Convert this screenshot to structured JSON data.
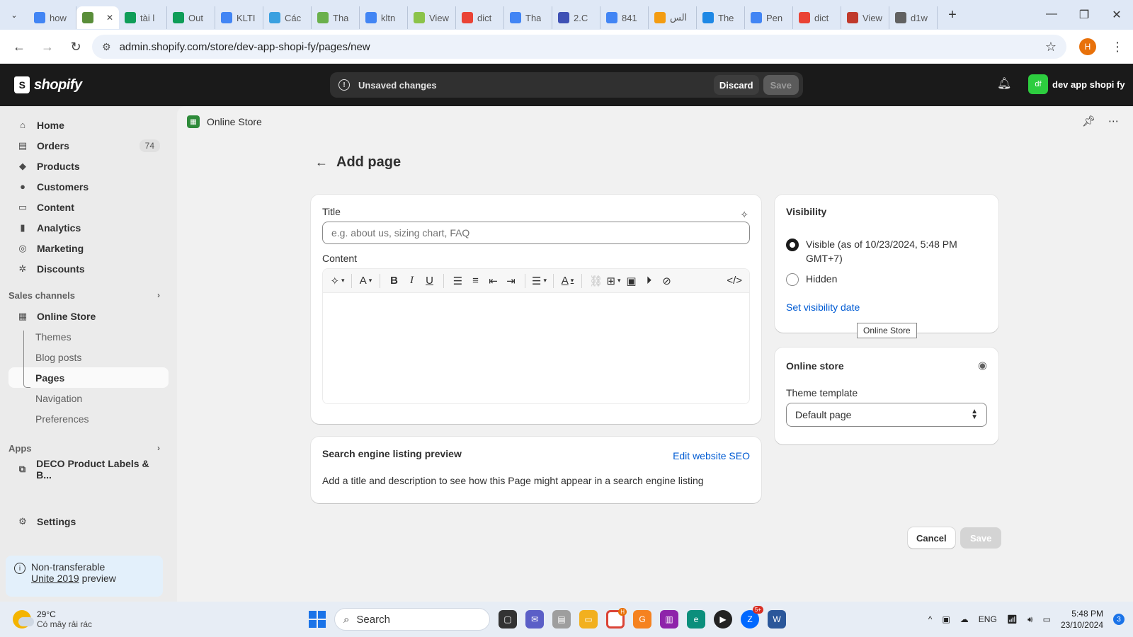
{
  "browser": {
    "tabs": [
      {
        "label": "how",
        "icon": "docs-icon",
        "color": "#4285f4"
      },
      {
        "label": "",
        "icon": "shopify-icon",
        "color": "#5a8e3a",
        "active": true
      },
      {
        "label": "tài l",
        "icon": "sheets-icon",
        "color": "#0f9d58"
      },
      {
        "label": "Out",
        "icon": "sheets-icon",
        "color": "#0f9d58"
      },
      {
        "label": "KLTI",
        "icon": "docs-icon",
        "color": "#4285f4"
      },
      {
        "label": "Các",
        "icon": "globe-icon",
        "color": "#3aa0e0"
      },
      {
        "label": "Tha",
        "icon": "leaf-icon",
        "color": "#6ab04c"
      },
      {
        "label": "kltn",
        "icon": "docs-icon",
        "color": "#4285f4"
      },
      {
        "label": "View",
        "icon": "image-icon",
        "color": "#8bc34a"
      },
      {
        "label": "dict",
        "icon": "google-icon",
        "color": "#ea4335"
      },
      {
        "label": "Tha",
        "icon": "docs-icon",
        "color": "#4285f4"
      },
      {
        "label": "2.C",
        "icon": "yahoo-icon",
        "color": "#3f51b5"
      },
      {
        "label": "841",
        "icon": "file-icon",
        "color": "#4285f4"
      },
      {
        "label": "الس",
        "icon": "sun-icon",
        "color": "#f39c12"
      },
      {
        "label": "The",
        "icon": "diamond-icon",
        "color": "#1e88e5"
      },
      {
        "label": "Pen",
        "icon": "file-icon",
        "color": "#4285f4"
      },
      {
        "label": "dict",
        "icon": "google-icon",
        "color": "#ea4335"
      },
      {
        "label": "View",
        "icon": "ebook-icon",
        "color": "#c0392b"
      },
      {
        "label": "d1w",
        "icon": "globe-icon",
        "color": "#616161"
      }
    ],
    "url": "admin.shopify.com/store/dev-app-shopi-fy/pages/new",
    "profile_initial": "H"
  },
  "topbar": {
    "brand": "shopify",
    "unsaved_text": "Unsaved changes",
    "discard_label": "Discard",
    "save_label": "Save",
    "store_initials": "df",
    "store_name": "dev app shopi fy"
  },
  "sidebar": {
    "items": [
      {
        "label": "Home",
        "icon": "home-icon"
      },
      {
        "label": "Orders",
        "icon": "orders-icon",
        "count": "74"
      },
      {
        "label": "Products",
        "icon": "tag-icon"
      },
      {
        "label": "Customers",
        "icon": "person-icon"
      },
      {
        "label": "Content",
        "icon": "content-icon"
      },
      {
        "label": "Analytics",
        "icon": "bar-chart-icon"
      },
      {
        "label": "Marketing",
        "icon": "target-icon"
      },
      {
        "label": "Discounts",
        "icon": "discount-icon"
      }
    ],
    "sales_channels_label": "Sales channels",
    "online_store_label": "Online Store",
    "sub_items": [
      "Themes",
      "Blog posts",
      "Pages",
      "Navigation",
      "Preferences"
    ],
    "apps_label": "Apps",
    "app_item": "DECO Product Labels & B...",
    "settings_label": "Settings",
    "notice_line1": "Non-transferable",
    "notice_link": "Unite 2019",
    "notice_line2": "preview"
  },
  "breadcrumb": {
    "label": "Online Store"
  },
  "page": {
    "title": "Add page",
    "title_label": "Title",
    "title_placeholder": "e.g. about us, sizing chart, FAQ",
    "content_label": "Content",
    "seo_title": "Search engine listing preview",
    "seo_edit": "Edit website SEO",
    "seo_desc": "Add a title and description to see how this Page might appear in a search engine listing",
    "cancel_label": "Cancel",
    "save_label": "Save"
  },
  "visibility": {
    "title": "Visibility",
    "visible_label": "Visible (as of 10/23/2024, 5:48 PM GMT+7)",
    "hidden_label": "Hidden",
    "set_date_link": "Set visibility date",
    "selected": "visible"
  },
  "tooltip": "Online Store",
  "online_store_card": {
    "title": "Online store",
    "template_label": "Theme template",
    "template_value": "Default page"
  },
  "taskbar": {
    "temperature": "29°C",
    "weather_desc": "Có mây rải rác",
    "search_label": "Search",
    "lang": "ENG",
    "time": "5:48 PM",
    "date": "23/10/2024",
    "notifications": "3",
    "zalo_badge": "5+",
    "chrome_badge": "H"
  }
}
